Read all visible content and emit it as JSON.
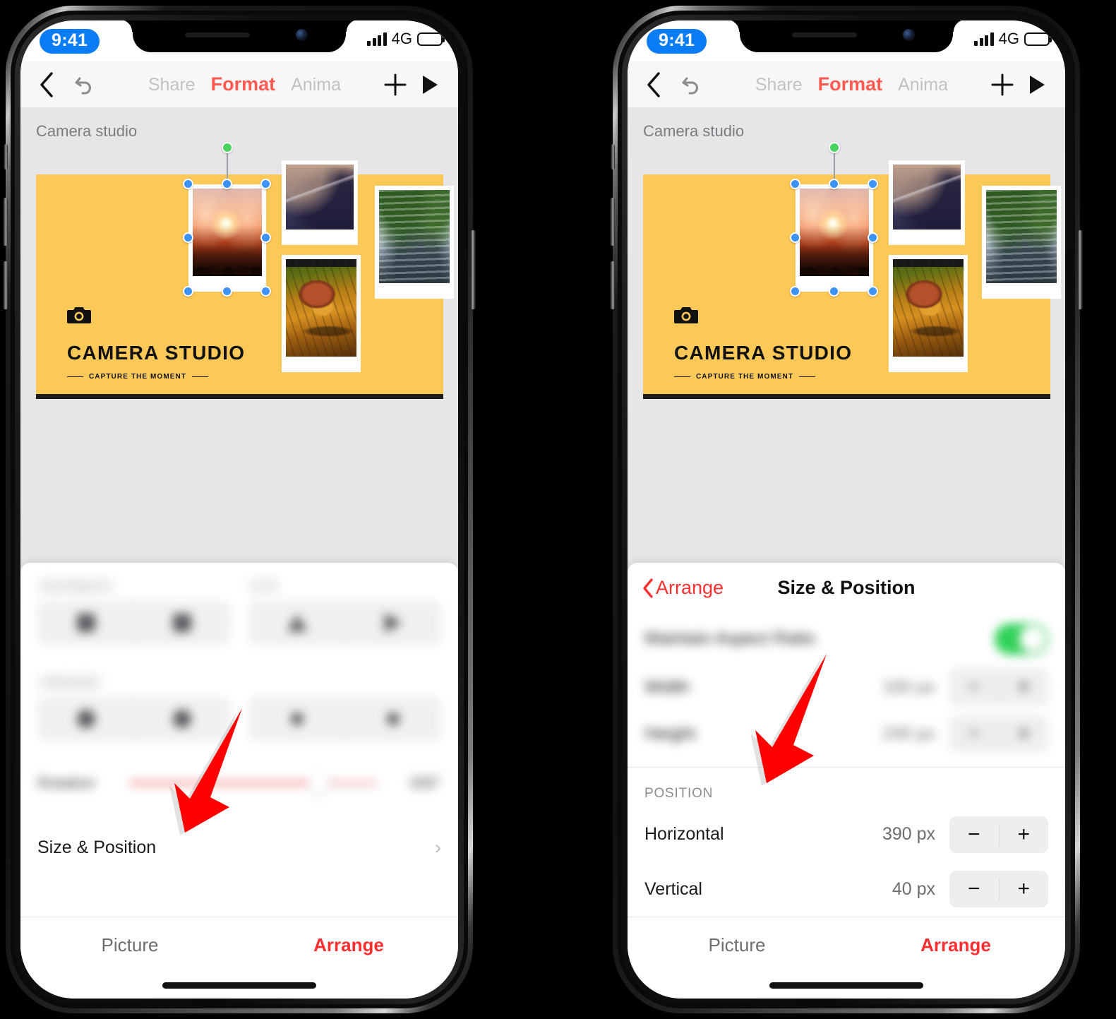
{
  "status_bar": {
    "time": "9:41",
    "network": "4G",
    "battery_icon": "battery-icon",
    "signal_icon": "signal-icon"
  },
  "toolbar": {
    "back_icon": "chevron-left-icon",
    "undo_icon": "undo-icon",
    "tabs": [
      {
        "label": "Share",
        "active": false
      },
      {
        "label": "Format",
        "active": true
      },
      {
        "label": "Animat",
        "active": false
      }
    ],
    "add_icon": "plus-icon",
    "play_icon": "play-icon"
  },
  "canvas": {
    "document_title": "Camera studio",
    "slide": {
      "brand_title": "CAMERA STUDIO",
      "brand_subtitle": "CAPTURE THE MOMENT",
      "camera_icon": "camera-icon",
      "background_color": "#fcc857",
      "photos": [
        {
          "name": "sunset-photo",
          "selected": true
        },
        {
          "name": "mountain-photo",
          "selected": false
        },
        {
          "name": "spider-photo",
          "selected": false
        },
        {
          "name": "waterfall-photo",
          "selected": false
        }
      ]
    },
    "selection": {
      "handle_color": "#3d92f5",
      "rotation_handle_color": "#4cd35f"
    }
  },
  "left_panel": {
    "distribute_label": "DISTRIBUTE",
    "flip_label": "FLIP",
    "arrange_label": "ARRANGE",
    "rotation_label": "Rotation",
    "rotation_value": "330°",
    "size_position_label": "Size & Position",
    "chevron_icon": "chevron-right-icon"
  },
  "right_panel": {
    "back_label": "Arrange",
    "back_icon": "chevron-left-icon",
    "title": "Size & Position",
    "aspect_ratio_label": "Maintain Aspect Ratio",
    "aspect_ratio_on": true,
    "size_rows": [
      {
        "label": "Width",
        "value": "160 px"
      },
      {
        "label": "Height",
        "value": "240 px"
      }
    ],
    "position_section": "POSITION",
    "position_rows": [
      {
        "label": "Horizontal",
        "value": "390 px"
      },
      {
        "label": "Vertical",
        "value": "40 px"
      }
    ],
    "minus_icon": "minus-icon",
    "plus_icon": "plus-icon"
  },
  "tabbar": {
    "picture": "Picture",
    "arrange": "Arrange",
    "active": "Arrange"
  },
  "annotations": {
    "arrow_color": "#ff0000",
    "left_arrow_target": "Size & Position",
    "right_arrow_target": "POSITION"
  }
}
